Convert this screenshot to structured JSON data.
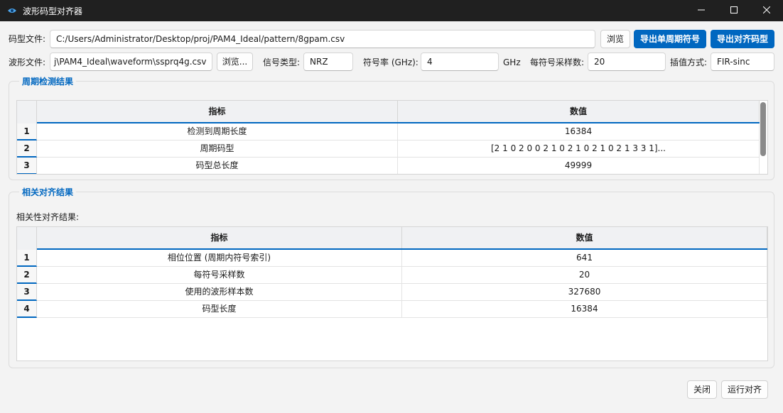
{
  "window": {
    "title": "波形码型对齐器",
    "controls": {
      "minimize": "minimize-icon",
      "maximize": "maximize-icon",
      "close": "close-icon"
    }
  },
  "pattern_row": {
    "label": "码型文件:",
    "path": "C:/Users/Administrator/Desktop/proj/PAM4_Ideal/pattern/8gpam.csv",
    "browse_label": "浏览",
    "export_single_label": "导出单周期符号",
    "export_aligned_label": "导出对齐码型"
  },
  "waveform_row": {
    "label": "波形文件:",
    "path": "j\\PAM4_Ideal\\waveform\\ssprq4g.csv",
    "browse_label": "浏览...",
    "signal_type_label": "信号类型:",
    "signal_type_value": "NRZ",
    "symbol_rate_label": "符号率 (GHz):",
    "symbol_rate_value": "4",
    "symbol_rate_unit": "GHz",
    "samples_per_symbol_label": "每符号采样数:",
    "samples_per_symbol_value": "20",
    "interp_label": "插值方式:",
    "interp_value": "FIR-sinc"
  },
  "period_group": {
    "title": "周期检测结果",
    "columns": [
      "指标",
      "数值"
    ],
    "rows": [
      {
        "index": "1",
        "metric": "检测到周期长度",
        "value": "16384"
      },
      {
        "index": "2",
        "metric": "周期码型",
        "value": "[2 1 0 2 0 0 2 1 0 2 1 0 2 1 0 2 1 3 3 1]..."
      },
      {
        "index": "3",
        "metric": "码型总长度",
        "value": "49999"
      }
    ]
  },
  "corr_group": {
    "title": "相关对齐结果",
    "subtitle": "相关性对齐结果:",
    "columns": [
      "指标",
      "数值"
    ],
    "rows": [
      {
        "index": "1",
        "metric": "相位位置 (周期内符号索引)",
        "value": "641"
      },
      {
        "index": "2",
        "metric": "每符号采样数",
        "value": "20"
      },
      {
        "index": "3",
        "metric": "使用的波形样本数",
        "value": "327680"
      },
      {
        "index": "4",
        "metric": "码型长度",
        "value": "16384"
      }
    ]
  },
  "footer": {
    "close_label": "关闭",
    "run_label": "运行对齐"
  },
  "colors": {
    "accent": "#0067c0",
    "titlebar": "#202020",
    "background": "#f3f3f3"
  }
}
